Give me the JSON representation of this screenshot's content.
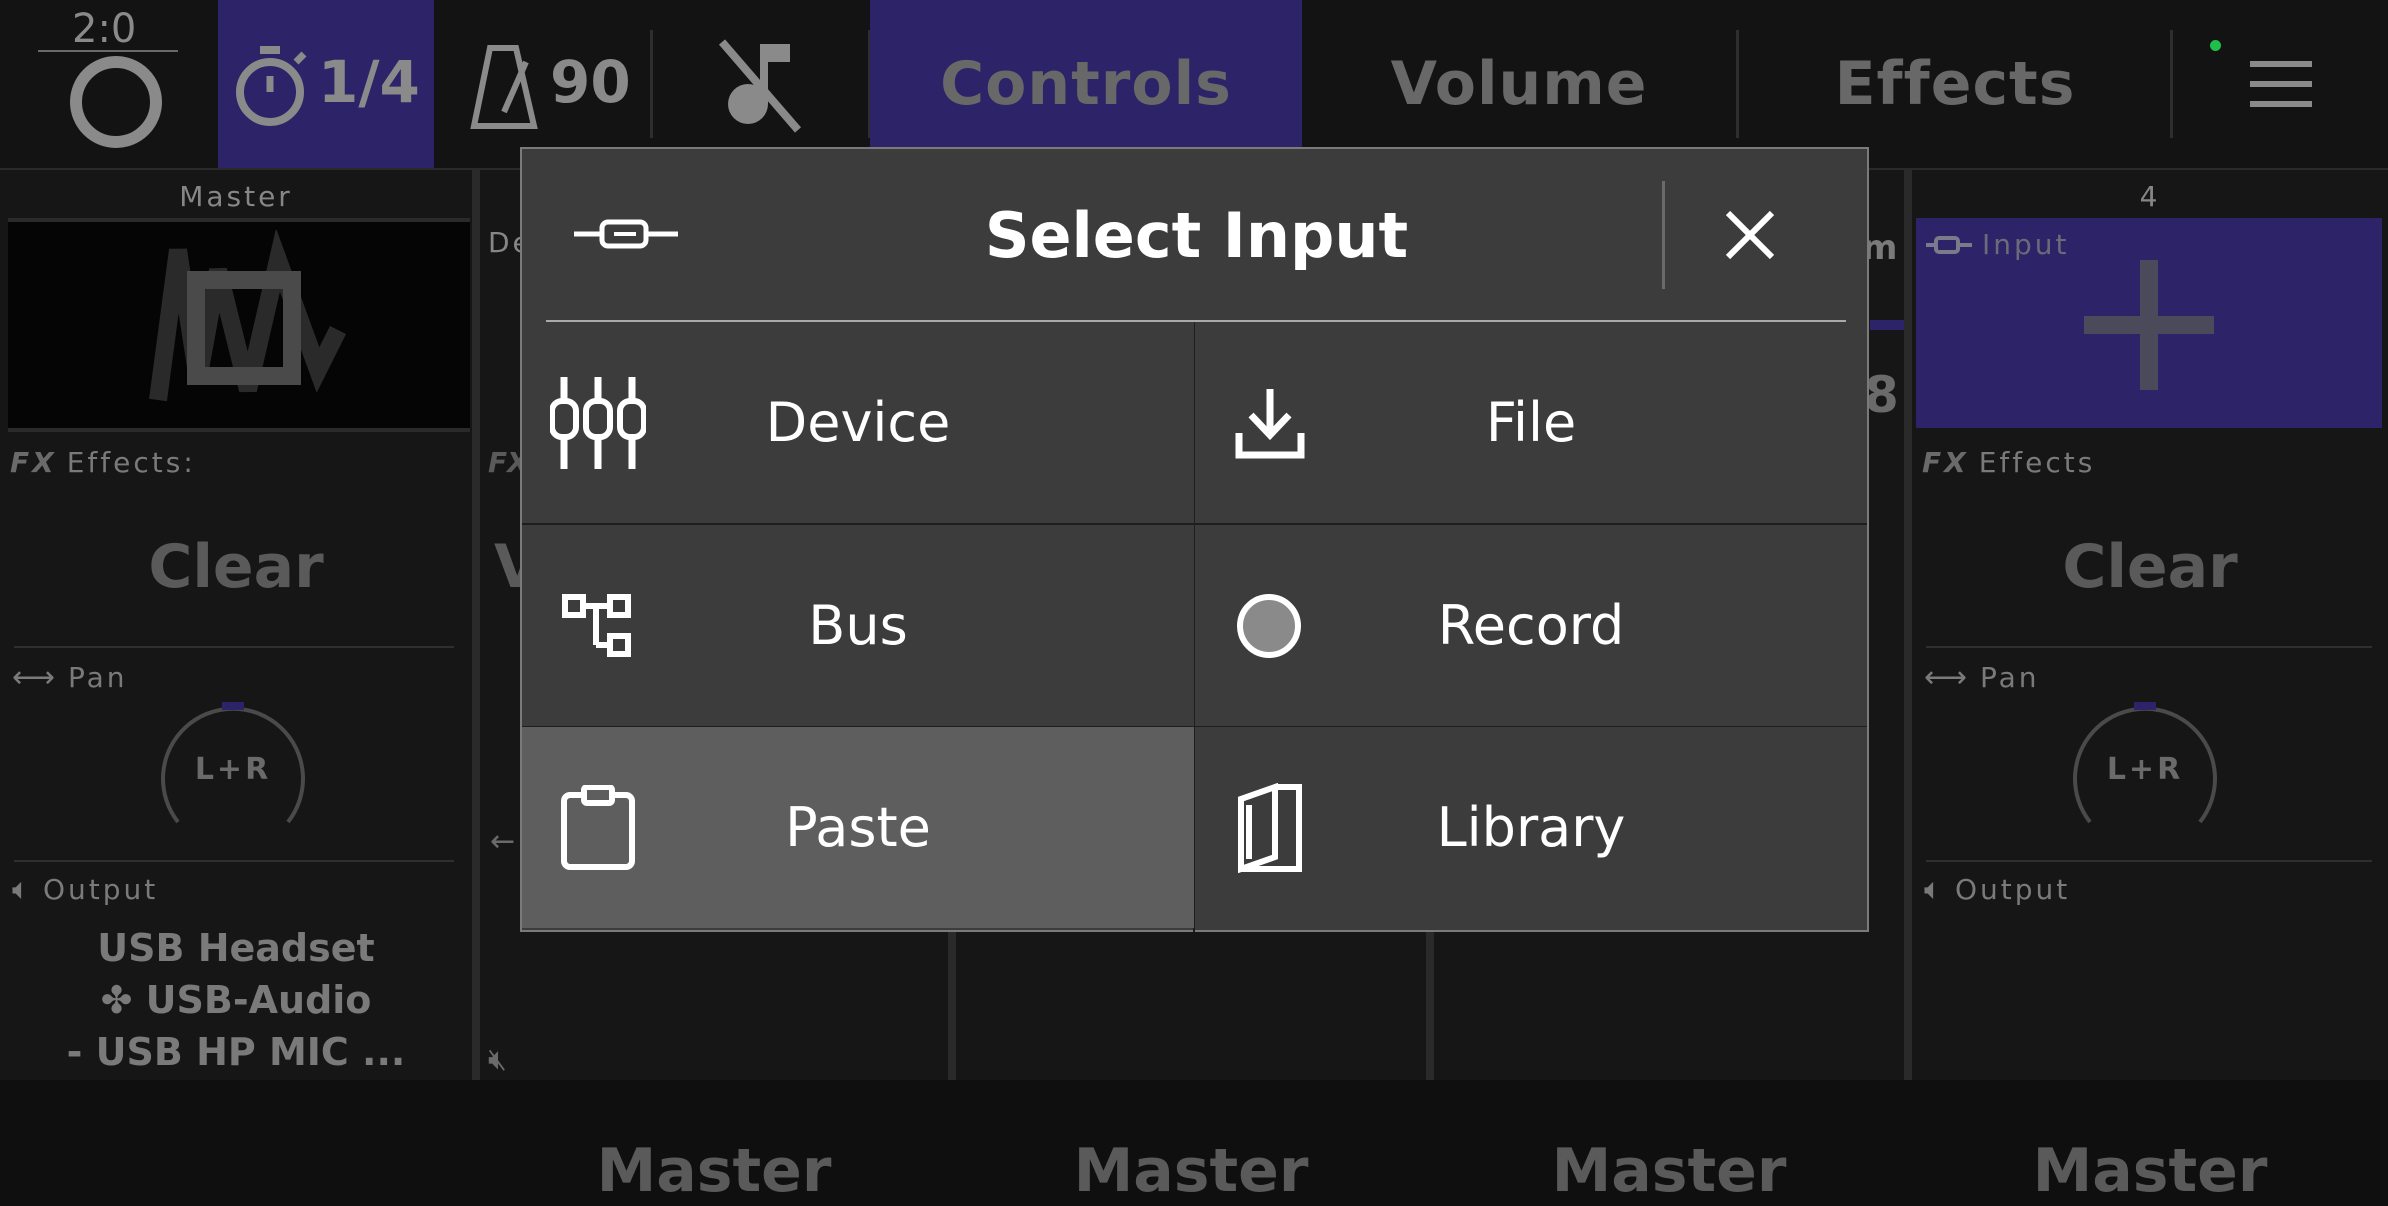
{
  "topbar": {
    "time_signature": "2:0",
    "quantize": "1/4",
    "tempo": "90",
    "tabs": [
      "Controls",
      "Volume",
      "Effects"
    ],
    "accent": "#2c2368"
  },
  "channels": {
    "master": {
      "header": "Master",
      "effects_label": "Effects:",
      "effects_value": "Clear",
      "pan_label": "Pan",
      "pan_value": "L+R",
      "output_label": "Output",
      "output_lines": [
        "USB Headset",
        "✤ USB-Audio",
        "- USB HP MIC ..."
      ]
    },
    "ch2": {
      "header_partial": "De",
      "effects_partial": "V",
      "output": "Master"
    },
    "ch3": {
      "output": "Master"
    },
    "ch4_partial": {
      "header_partial": "m",
      "number_partial": "8",
      "output": "Master"
    },
    "ch4": {
      "number": "4",
      "input_label": "Input",
      "effects_label": "Effects",
      "effects_value": "Clear",
      "pan_label": "Pan",
      "pan_value": "L+R",
      "output_label": "Output",
      "output": "Master"
    }
  },
  "modal": {
    "title": "Select Input",
    "options": [
      {
        "label": "Device",
        "icon": "sliders-icon"
      },
      {
        "label": "File",
        "icon": "download-icon"
      },
      {
        "label": "Bus",
        "icon": "bus-tree-icon"
      },
      {
        "label": "Record",
        "icon": "record-icon"
      },
      {
        "label": "Paste",
        "icon": "clipboard-icon"
      },
      {
        "label": "Library",
        "icon": "book-icon"
      }
    ]
  }
}
